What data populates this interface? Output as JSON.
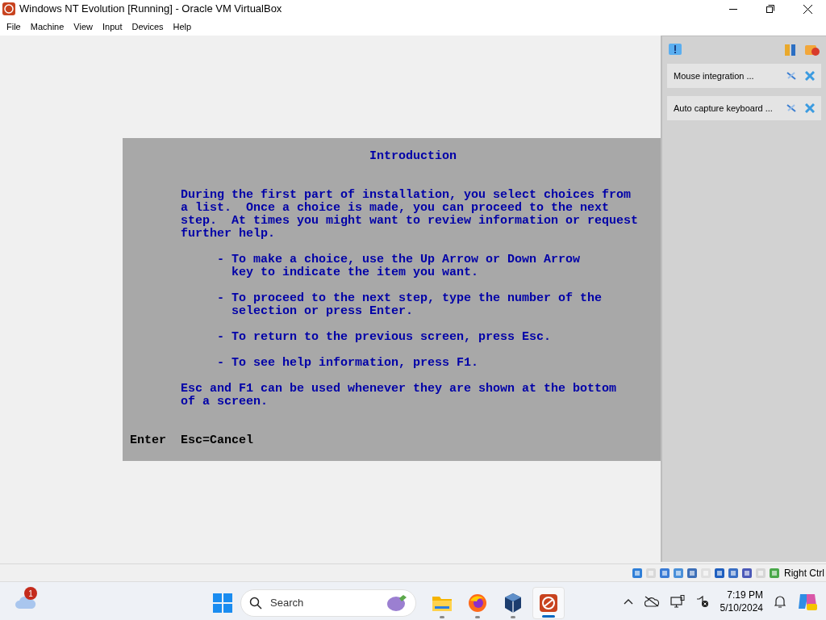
{
  "window": {
    "title": "Windows NT Evolution [Running] - Oracle VM VirtualBox"
  },
  "menu": [
    "File",
    "Machine",
    "View",
    "Input",
    "Devices",
    "Help"
  ],
  "vm_screen": {
    "title": "Introduction",
    "blocks": [
      {
        "kind": "text",
        "lines": [
          "During the first part of installation, you select choices from",
          "a list.  Once a choice is made, you can proceed to the next",
          "step.  At times you might want to review information or request",
          "further help."
        ]
      },
      {
        "kind": "bullet",
        "marker": "-",
        "lines": [
          "To make a choice, use the Up Arrow or Down Arrow",
          "key to indicate the item you want."
        ]
      },
      {
        "kind": "bullet",
        "marker": "-",
        "lines": [
          "To proceed to the next step, type the number of the",
          "selection or press Enter."
        ]
      },
      {
        "kind": "bullet",
        "marker": "-",
        "lines": [
          "To return to the previous screen, press Esc."
        ]
      },
      {
        "kind": "bullet",
        "marker": "-",
        "lines": [
          "To see help information, press F1."
        ]
      },
      {
        "kind": "text",
        "lines": [
          "Esc and F1 can be used whenever they are shown at the bottom",
          "of a screen."
        ]
      }
    ],
    "footer": [
      "Enter",
      "Esc=Cancel"
    ]
  },
  "notification_panel": {
    "notices": [
      {
        "text": "Mouse integration ..."
      },
      {
        "text": "Auto capture keyboard ..."
      }
    ]
  },
  "status_bar": {
    "host_key": "Right Ctrl"
  },
  "taskbar": {
    "weather_badge": "1",
    "search": {
      "placeholder": "Search"
    },
    "apps": [
      {
        "kind": "folder",
        "selected": false
      },
      {
        "kind": "firefox",
        "selected": false
      },
      {
        "kind": "virtualbox",
        "selected": false
      },
      {
        "kind": "vm",
        "selected": true
      }
    ],
    "time": "7:19 PM",
    "date": "5/10/2024"
  }
}
